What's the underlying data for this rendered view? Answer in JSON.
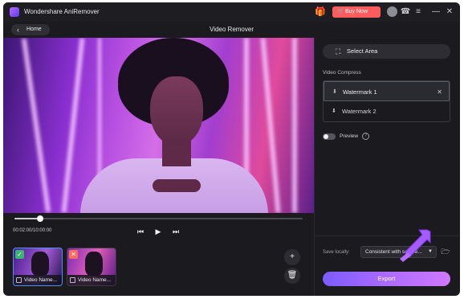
{
  "titlebar": {
    "app_name": "Wondershare AniRemover",
    "buy_now_label": "Buy Now",
    "icons": [
      "gift-icon",
      "cart-icon",
      "avatar",
      "support-icon",
      "menu-icon",
      "minimize-icon",
      "close-icon"
    ]
  },
  "header": {
    "home_label": "Home",
    "page_title": "Video Remover"
  },
  "player": {
    "timecode": "00:02:00/10:00:00",
    "progress_fraction": 0.09
  },
  "thumbnails": [
    {
      "caption": "Video Name...",
      "status": "done"
    },
    {
      "caption": "Video Name...",
      "status": "error"
    }
  ],
  "panel": {
    "select_area_label": "Select Area",
    "section_label": "Video Compress",
    "watermarks": [
      {
        "label": "Watermark 1",
        "active": true
      },
      {
        "label": "Watermark 2",
        "active": false
      }
    ],
    "preview_label": "Preview",
    "save_locally_label": "Save locally:",
    "save_option": "Consistent with source...",
    "export_label": "Export"
  },
  "colors": {
    "accent": "#9a6bff",
    "buy_now": "#ff5d5d",
    "success": "#3cb371",
    "error": "#ff6b5a"
  }
}
